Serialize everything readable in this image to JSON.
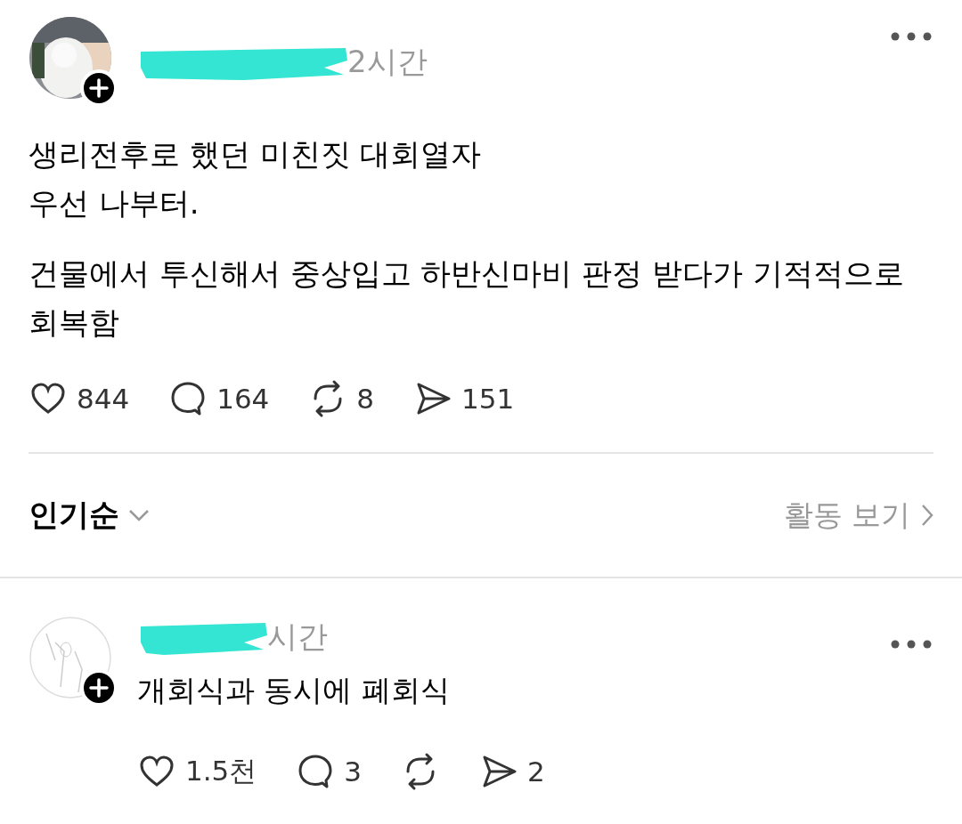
{
  "post": {
    "time": "2시간",
    "paragraphs": [
      "생리전후로 했던 미친짓 대회열자\n우선 나부터.",
      "건물에서 투신해서 중상입고 하반신마비 판정 받다가 기적적으로 회복함"
    ],
    "actions": [
      {
        "kind": "like",
        "count": "844"
      },
      {
        "kind": "comment",
        "count": "164"
      },
      {
        "kind": "repost",
        "count": "8"
      },
      {
        "kind": "share",
        "count": "151"
      }
    ]
  },
  "sort": {
    "label": "인기순",
    "activity_link": "활동 보기"
  },
  "reply": {
    "time": "시간",
    "text": "개회식과 동시에 폐회식",
    "actions": [
      {
        "kind": "like",
        "count": "1.5천"
      },
      {
        "kind": "comment",
        "count": "3"
      },
      {
        "kind": "repost"
      },
      {
        "kind": "share",
        "count": "2"
      }
    ]
  }
}
